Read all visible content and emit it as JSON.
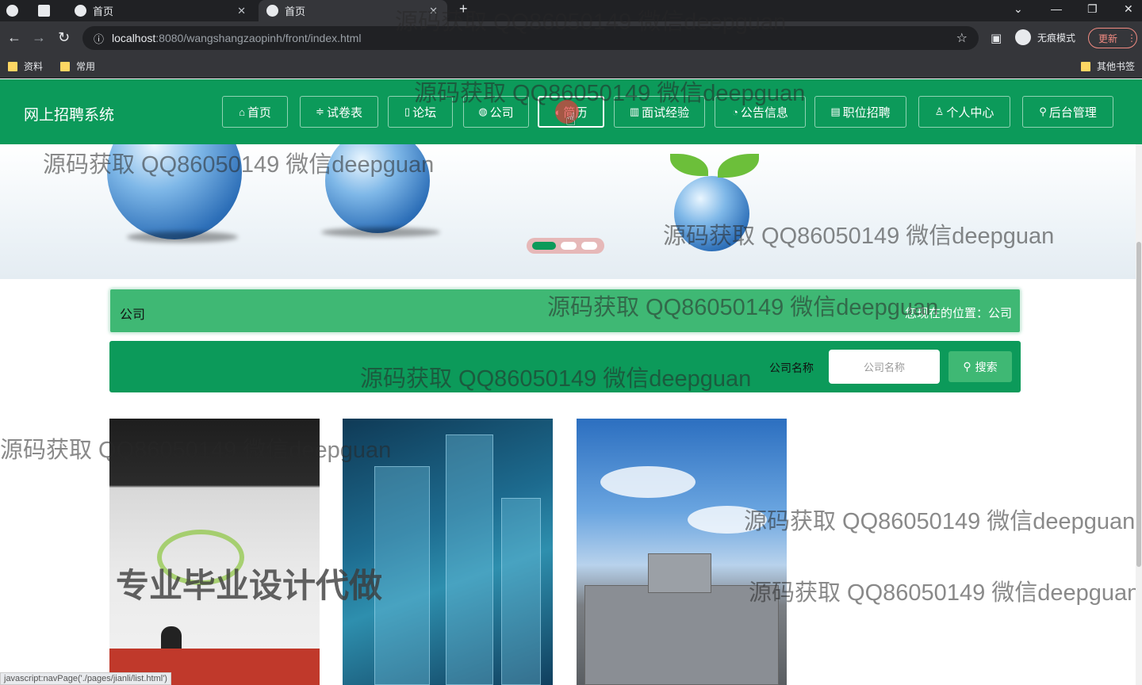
{
  "browser": {
    "tabs": [
      {
        "label": "首页"
      },
      {
        "label": "首页"
      }
    ],
    "url_host": "localhost",
    "url_rest": ":8080/wangshangzaopinh/front/index.html",
    "incognito_label": "无痕模式",
    "update_label": "更新",
    "bookmarks": [
      "资料",
      "常用"
    ],
    "other_bookmarks": "其他书签"
  },
  "site": {
    "title": "网上招聘系统",
    "nav": [
      {
        "icon": "⌂",
        "label": "首页"
      },
      {
        "icon": "≑",
        "label": "试卷表"
      },
      {
        "icon": "▯",
        "label": "论坛"
      },
      {
        "icon": "◍",
        "label": "公司"
      },
      {
        "icon": "◐",
        "label": "简历"
      },
      {
        "icon": "▥",
        "label": "面试经验"
      },
      {
        "icon": "◔",
        "label": "公告信息"
      },
      {
        "icon": "▤",
        "label": "职位招聘"
      },
      {
        "icon": "♙",
        "label": "个人中心"
      },
      {
        "icon": "⚲",
        "label": "后台管理"
      }
    ]
  },
  "breadcrumb": {
    "current": "公司",
    "location_label": "您现在的位置：公司"
  },
  "search": {
    "label": "公司名称",
    "placeholder": "公司名称",
    "button": "搜索"
  },
  "overlay_text": "专业毕业设计代做",
  "status_url": "javascript:navPage('./pages/jianli/list.html')",
  "watermark": "源码获取 QQ86050149 微信deepguan",
  "colors": {
    "primary": "#0c9a5a",
    "secondary": "#3fb874"
  }
}
